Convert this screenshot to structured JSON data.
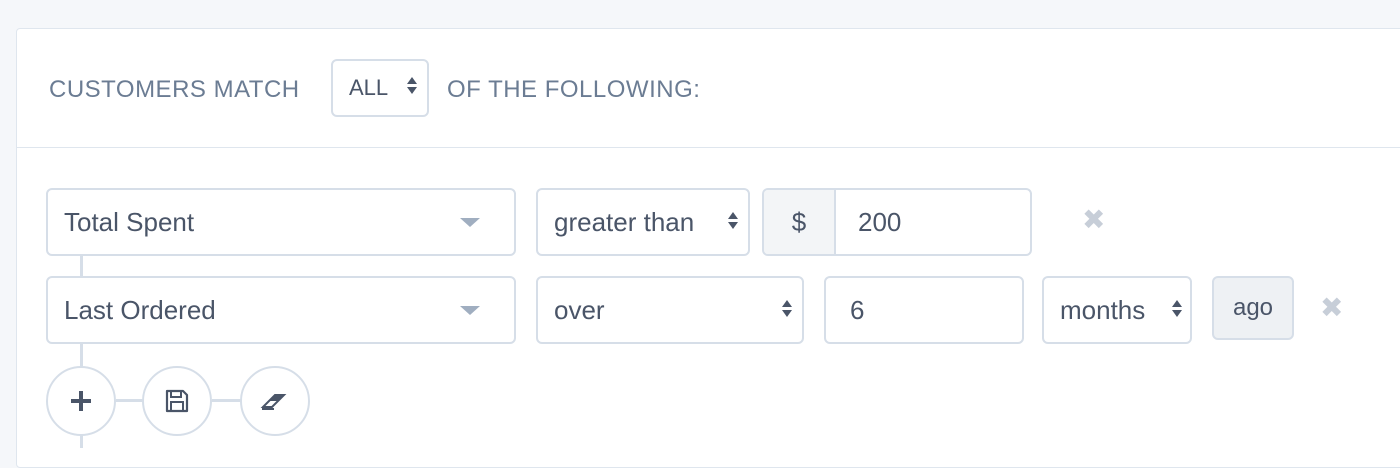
{
  "header": {
    "prefix_text": "CUSTOMERS MATCH",
    "match_value": "ALL",
    "suffix_text": "OF THE FOLLOWING:"
  },
  "rules": [
    {
      "field": "Total Spent",
      "operator": "greater than",
      "currency_symbol": "$",
      "value": "200"
    },
    {
      "field": "Last Ordered",
      "operator": "over",
      "value": "6",
      "unit": "months",
      "suffix": "ago"
    }
  ],
  "actions": {
    "add_icon": "plus-icon",
    "save_icon": "floppy-disk-icon",
    "clear_icon": "eraser-icon"
  },
  "remove_icon": "✖"
}
